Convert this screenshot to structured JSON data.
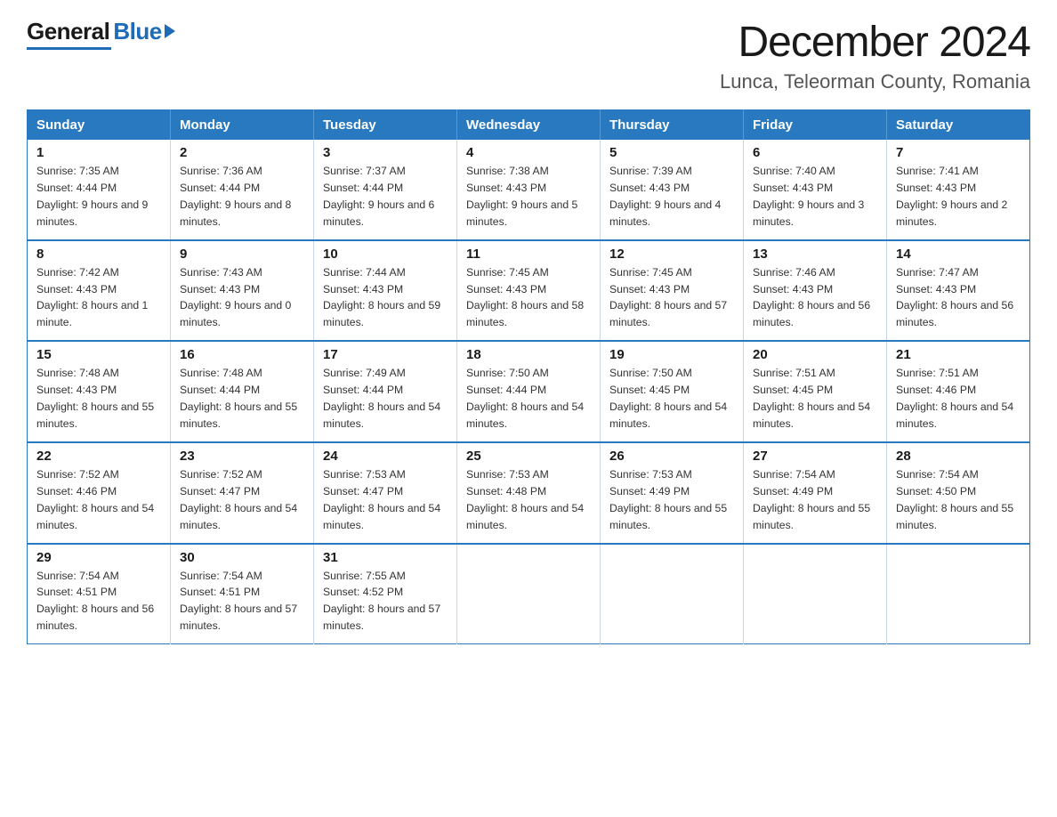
{
  "header": {
    "logo_general": "General",
    "logo_blue": "Blue",
    "main_title": "December 2024",
    "subtitle": "Lunca, Teleorman County, Romania"
  },
  "calendar": {
    "days_of_week": [
      "Sunday",
      "Monday",
      "Tuesday",
      "Wednesday",
      "Thursday",
      "Friday",
      "Saturday"
    ],
    "weeks": [
      [
        {
          "day": "1",
          "sunrise": "7:35 AM",
          "sunset": "4:44 PM",
          "daylight": "9 hours and 9 minutes."
        },
        {
          "day": "2",
          "sunrise": "7:36 AM",
          "sunset": "4:44 PM",
          "daylight": "9 hours and 8 minutes."
        },
        {
          "day": "3",
          "sunrise": "7:37 AM",
          "sunset": "4:44 PM",
          "daylight": "9 hours and 6 minutes."
        },
        {
          "day": "4",
          "sunrise": "7:38 AM",
          "sunset": "4:43 PM",
          "daylight": "9 hours and 5 minutes."
        },
        {
          "day": "5",
          "sunrise": "7:39 AM",
          "sunset": "4:43 PM",
          "daylight": "9 hours and 4 minutes."
        },
        {
          "day": "6",
          "sunrise": "7:40 AM",
          "sunset": "4:43 PM",
          "daylight": "9 hours and 3 minutes."
        },
        {
          "day": "7",
          "sunrise": "7:41 AM",
          "sunset": "4:43 PM",
          "daylight": "9 hours and 2 minutes."
        }
      ],
      [
        {
          "day": "8",
          "sunrise": "7:42 AM",
          "sunset": "4:43 PM",
          "daylight": "8 hours and 1 minute."
        },
        {
          "day": "9",
          "sunrise": "7:43 AM",
          "sunset": "4:43 PM",
          "daylight": "9 hours and 0 minutes."
        },
        {
          "day": "10",
          "sunrise": "7:44 AM",
          "sunset": "4:43 PM",
          "daylight": "8 hours and 59 minutes."
        },
        {
          "day": "11",
          "sunrise": "7:45 AM",
          "sunset": "4:43 PM",
          "daylight": "8 hours and 58 minutes."
        },
        {
          "day": "12",
          "sunrise": "7:45 AM",
          "sunset": "4:43 PM",
          "daylight": "8 hours and 57 minutes."
        },
        {
          "day": "13",
          "sunrise": "7:46 AM",
          "sunset": "4:43 PM",
          "daylight": "8 hours and 56 minutes."
        },
        {
          "day": "14",
          "sunrise": "7:47 AM",
          "sunset": "4:43 PM",
          "daylight": "8 hours and 56 minutes."
        }
      ],
      [
        {
          "day": "15",
          "sunrise": "7:48 AM",
          "sunset": "4:43 PM",
          "daylight": "8 hours and 55 minutes."
        },
        {
          "day": "16",
          "sunrise": "7:48 AM",
          "sunset": "4:44 PM",
          "daylight": "8 hours and 55 minutes."
        },
        {
          "day": "17",
          "sunrise": "7:49 AM",
          "sunset": "4:44 PM",
          "daylight": "8 hours and 54 minutes."
        },
        {
          "day": "18",
          "sunrise": "7:50 AM",
          "sunset": "4:44 PM",
          "daylight": "8 hours and 54 minutes."
        },
        {
          "day": "19",
          "sunrise": "7:50 AM",
          "sunset": "4:45 PM",
          "daylight": "8 hours and 54 minutes."
        },
        {
          "day": "20",
          "sunrise": "7:51 AM",
          "sunset": "4:45 PM",
          "daylight": "8 hours and 54 minutes."
        },
        {
          "day": "21",
          "sunrise": "7:51 AM",
          "sunset": "4:46 PM",
          "daylight": "8 hours and 54 minutes."
        }
      ],
      [
        {
          "day": "22",
          "sunrise": "7:52 AM",
          "sunset": "4:46 PM",
          "daylight": "8 hours and 54 minutes."
        },
        {
          "day": "23",
          "sunrise": "7:52 AM",
          "sunset": "4:47 PM",
          "daylight": "8 hours and 54 minutes."
        },
        {
          "day": "24",
          "sunrise": "7:53 AM",
          "sunset": "4:47 PM",
          "daylight": "8 hours and 54 minutes."
        },
        {
          "day": "25",
          "sunrise": "7:53 AM",
          "sunset": "4:48 PM",
          "daylight": "8 hours and 54 minutes."
        },
        {
          "day": "26",
          "sunrise": "7:53 AM",
          "sunset": "4:49 PM",
          "daylight": "8 hours and 55 minutes."
        },
        {
          "day": "27",
          "sunrise": "7:54 AM",
          "sunset": "4:49 PM",
          "daylight": "8 hours and 55 minutes."
        },
        {
          "day": "28",
          "sunrise": "7:54 AM",
          "sunset": "4:50 PM",
          "daylight": "8 hours and 55 minutes."
        }
      ],
      [
        {
          "day": "29",
          "sunrise": "7:54 AM",
          "sunset": "4:51 PM",
          "daylight": "8 hours and 56 minutes."
        },
        {
          "day": "30",
          "sunrise": "7:54 AM",
          "sunset": "4:51 PM",
          "daylight": "8 hours and 57 minutes."
        },
        {
          "day": "31",
          "sunrise": "7:55 AM",
          "sunset": "4:52 PM",
          "daylight": "8 hours and 57 minutes."
        },
        null,
        null,
        null,
        null
      ]
    ]
  }
}
